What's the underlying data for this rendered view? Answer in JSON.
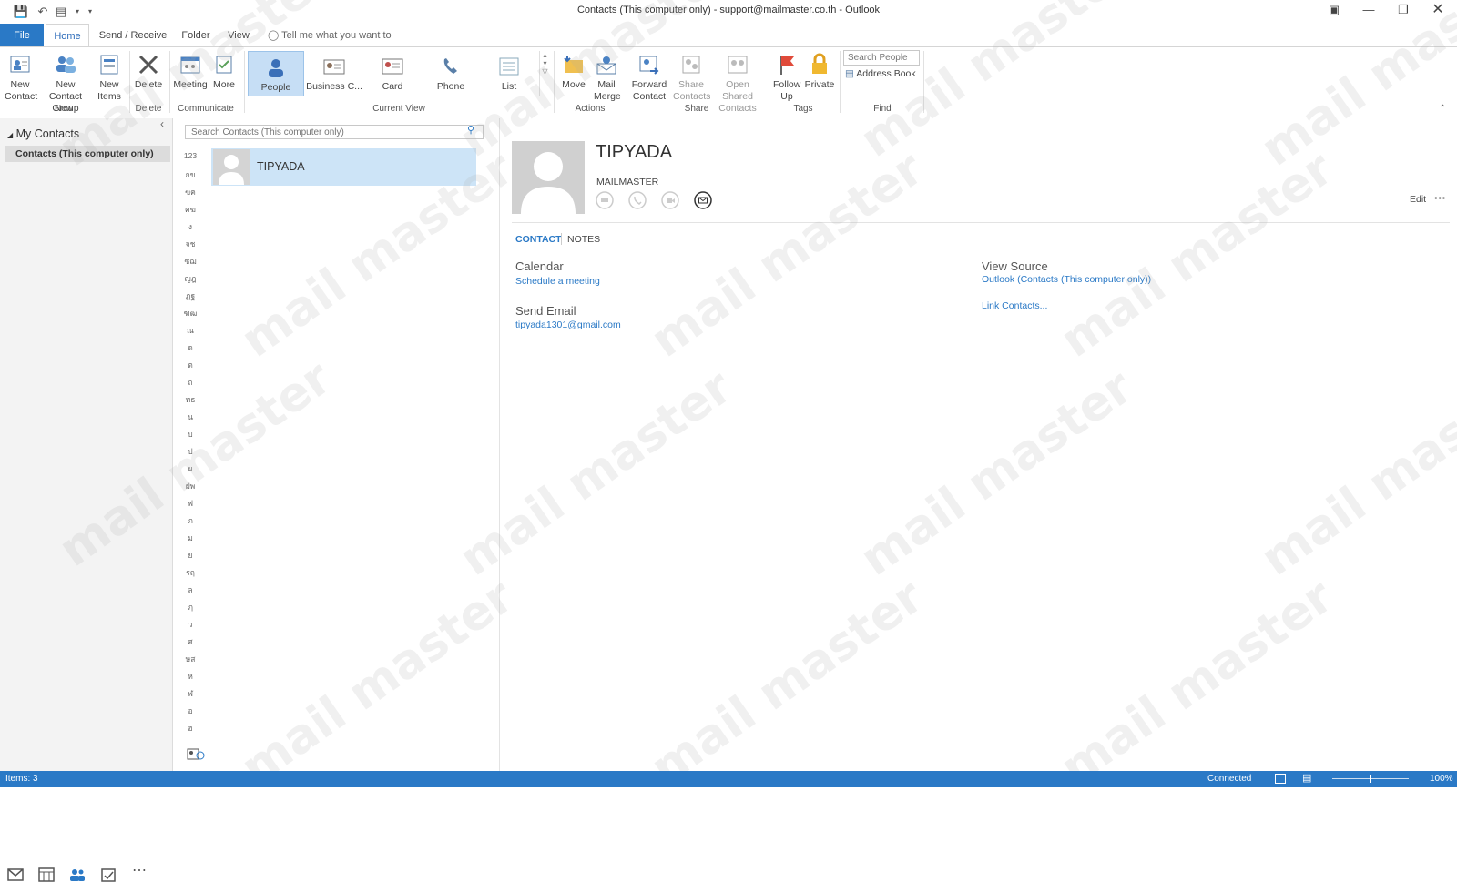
{
  "window": {
    "title": "Contacts (This computer only) - support@mailmaster.co.th  -  Outlook"
  },
  "tabs": [
    {
      "label": "File"
    },
    {
      "label": "Home"
    },
    {
      "label": "Send / Receive"
    },
    {
      "label": "Folder"
    },
    {
      "label": "View"
    }
  ],
  "tell_me": "Tell me what you want to do",
  "ribbon": {
    "new_contact": "New Contact",
    "new_contact_group": "New Contact Group",
    "new_items": "New Items",
    "delete": "Delete",
    "meeting": "Meeting",
    "more": "More",
    "views": [
      "People",
      "Business C...",
      "Card",
      "Phone",
      "List"
    ],
    "move": "Move",
    "mail_merge": "Mail Merge",
    "forward_contact": "Forward Contact",
    "share_contacts": "Share Contacts",
    "open_shared_contacts": "Open Shared Contacts",
    "follow_up": "Follow Up",
    "private": "Private",
    "search_people_placeholder": "Search People",
    "address_book": "Address Book",
    "groups": {
      "new": "New",
      "delete": "Delete",
      "communicate": "Communicate",
      "current_view": "Current View",
      "actions": "Actions",
      "share": "Share",
      "tags": "Tags",
      "find": "Find"
    }
  },
  "folders": {
    "header": "My Contacts",
    "selected": "Contacts (This computer only)"
  },
  "list": {
    "search_placeholder": "Search Contacts (This computer only)",
    "alphabet": [
      "123",
      "กข",
      "ฃค",
      "ฅฆ",
      "ง",
      "จช",
      "ซฌ",
      "ญฎ",
      "ฏฐ",
      "ฑฒ",
      "ณ",
      "ด",
      "ต",
      "ถ",
      "ทธ",
      "น",
      "บ",
      "ป",
      "ผ",
      "ฝพ",
      "ฟ",
      "ภ",
      "ม",
      "ย",
      "รฤ",
      "ล",
      "ฦ",
      "ว",
      "ศ",
      "ษส",
      "ห",
      "ฬ",
      "อ",
      "ฮ"
    ],
    "contacts": [
      {
        "name": "TIPYADA"
      }
    ]
  },
  "detail": {
    "name": "TIPYADA",
    "company": "MAILMASTER",
    "edit": "Edit",
    "more": "···",
    "tabs": {
      "contact": "CONTACT",
      "notes": "NOTES"
    },
    "calendar_label": "Calendar",
    "calendar_link": "Schedule a meeting",
    "email_label": "Send Email",
    "email_value": "tipyada1301@gmail.com",
    "source_label": "View Source",
    "source_link": "Outlook (Contacts (This computer only))",
    "link_contacts": "Link Contacts..."
  },
  "status": {
    "items": "Items: 3",
    "connection": "Connected",
    "zoom": "100%"
  },
  "watermark": "mail master"
}
